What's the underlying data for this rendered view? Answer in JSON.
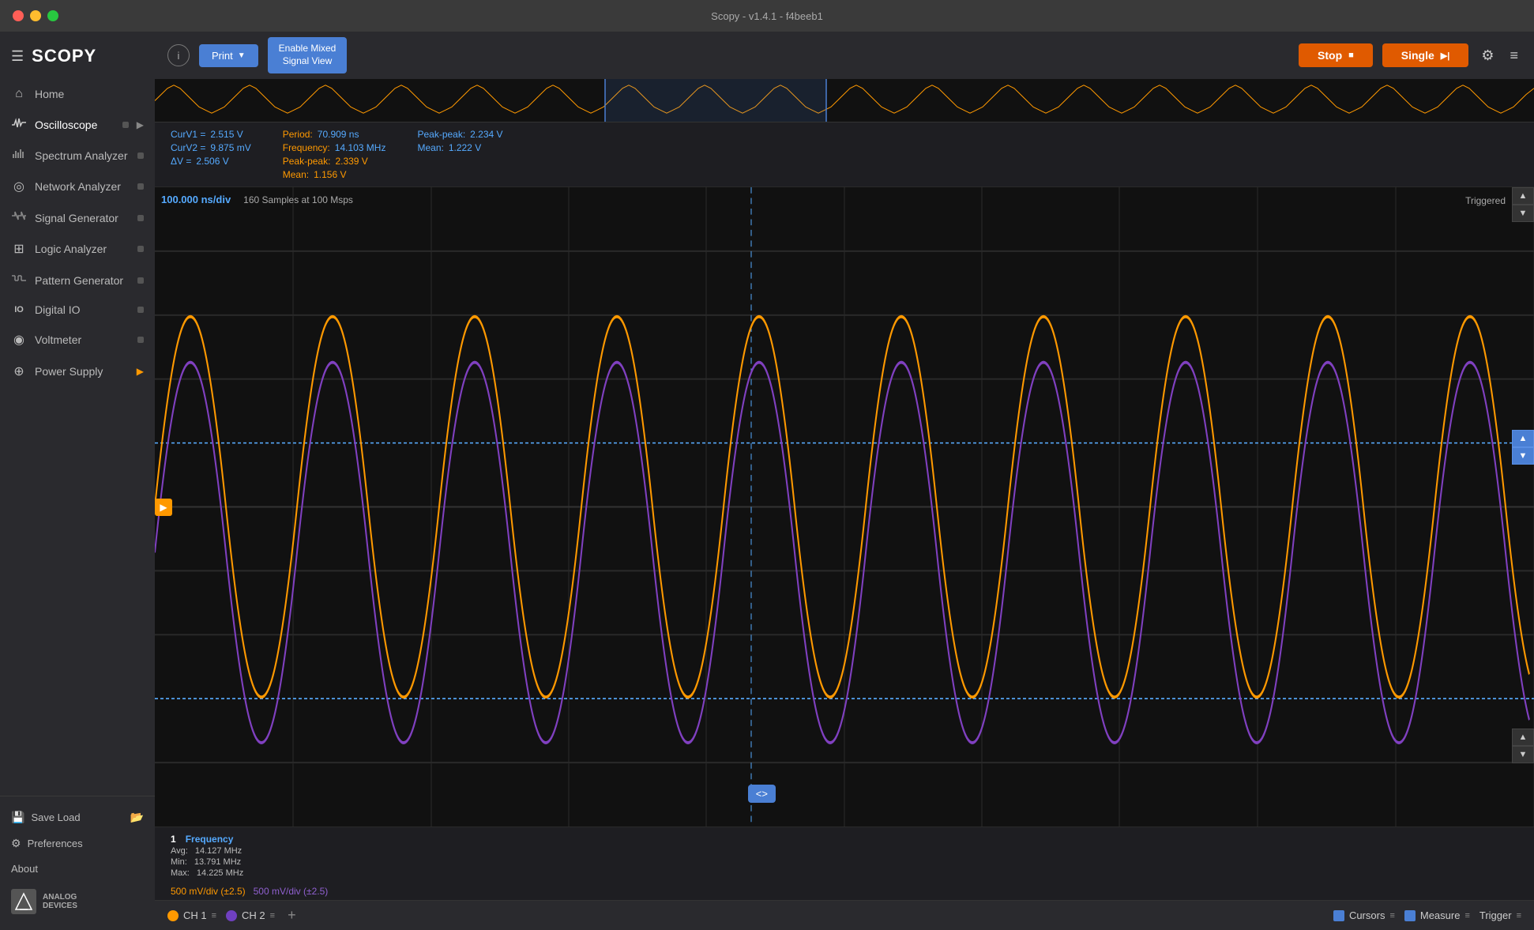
{
  "titlebar": {
    "title": "Scopy - v1.4.1 - f4beeb1"
  },
  "sidebar": {
    "logo": "SCOPY",
    "items": [
      {
        "id": "home",
        "label": "Home",
        "icon": "🏠",
        "badge": false,
        "arrow": false
      },
      {
        "id": "oscilloscope",
        "label": "Oscilloscope",
        "icon": "〜",
        "badge": true,
        "arrow": true
      },
      {
        "id": "spectrum",
        "label": "Spectrum Analyzer",
        "icon": "📊",
        "badge": true,
        "arrow": false
      },
      {
        "id": "network",
        "label": "Network Analyzer",
        "icon": "◎",
        "badge": true,
        "arrow": false
      },
      {
        "id": "signal-gen",
        "label": "Signal Generator",
        "icon": "〜",
        "badge": true,
        "arrow": false
      },
      {
        "id": "logic",
        "label": "Logic Analyzer",
        "icon": "⊞",
        "badge": true,
        "arrow": false
      },
      {
        "id": "pattern",
        "label": "Pattern Generator",
        "icon": "〒",
        "badge": true,
        "arrow": false
      },
      {
        "id": "digital-io",
        "label": "Digital IO",
        "icon": "IO",
        "badge": true,
        "arrow": false
      },
      {
        "id": "voltmeter",
        "label": "Voltmeter",
        "icon": "◉",
        "badge": true,
        "arrow": false
      },
      {
        "id": "power-supply",
        "label": "Power Supply",
        "icon": "⊕",
        "badge": false,
        "arrow": true,
        "arrow_orange": true
      }
    ],
    "footer": {
      "save_load": "Save  Load",
      "preferences": "Preferences",
      "about": "About"
    }
  },
  "toolbar": {
    "info_label": "i",
    "print_label": "Print",
    "mixed_signal_label": "Enable Mixed\nSignal View",
    "stop_label": "Stop",
    "single_label": "Single"
  },
  "measurements": {
    "curv1_label": "CurV1 =",
    "curv1_value": "2.515 V",
    "curv2_label": "CurV2 =",
    "curv2_value": "9.875 mV",
    "delta_label": "ΔV =",
    "delta_value": "2.506 V",
    "period_label": "Period:",
    "period_value": "70.909 ns",
    "freq_label": "Frequency:",
    "freq_value": "14.103 MHz",
    "pp_orange_label": "Peak-peak:",
    "pp_orange_value": "2.339 V",
    "mean_orange_label": "Mean:",
    "mean_orange_value": "1.156 V",
    "pp_blue_label": "Peak-peak:",
    "pp_blue_value": "2.234 V",
    "mean_blue_label": "Mean:",
    "mean_blue_value": "1.222 V"
  },
  "chart": {
    "time_per_div": "100.000 ns/div",
    "samples": "160  Samples at 100 Msps",
    "status": "Triggered",
    "scale_ch1": "500 mV/div (±2.5)",
    "scale_ch2": "500 mV/div (±2.5)"
  },
  "freq_display": {
    "number": "1",
    "label": "Frequency",
    "avg_label": "Avg:",
    "avg_value": "14.127 MHz",
    "min_label": "Min:",
    "min_value": "13.791 MHz",
    "max_label": "Max:",
    "max_value": "14.225 MHz"
  },
  "channels": {
    "ch1_label": "CH 1",
    "ch2_label": "CH 2",
    "add_label": "+",
    "cursors_label": "Cursors",
    "measure_label": "Measure",
    "trigger_label": "Trigger"
  },
  "cursor_handle": "<>"
}
